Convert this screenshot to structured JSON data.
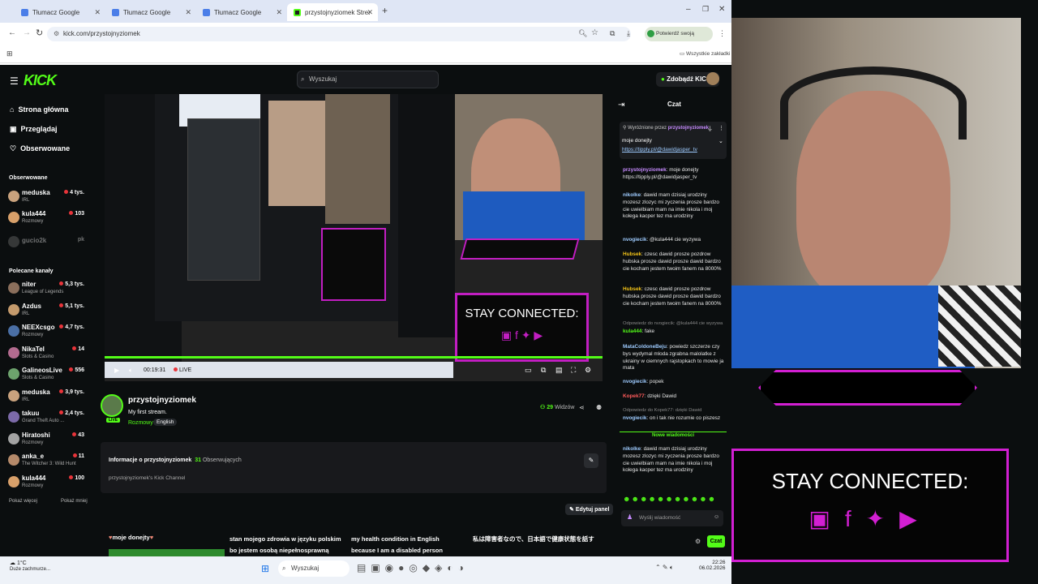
{
  "browser": {
    "tabs": [
      {
        "label": "Tłumacz Google"
      },
      {
        "label": "Tłumacz Google"
      },
      {
        "label": "Tłumacz Google"
      },
      {
        "label": "przystojnyziomek Stream - Wa"
      }
    ],
    "url": "kick.com/przystojnyziomek",
    "verify_label": "Potwierdź swoją tożsamość",
    "all_bookmarks": "Wszystkie zakładki"
  },
  "site": {
    "logo": "KICK",
    "search_placeholder": "Wyszukaj",
    "kicks_button": "Zdobądź KICKs",
    "nav": [
      "Strona główna",
      "Przeglądaj",
      "Obserwowane"
    ],
    "followed_header": "Obserwowane",
    "followed": [
      {
        "name": "meduska",
        "category": "IRL",
        "viewers": "4 tys."
      },
      {
        "name": "kula444",
        "category": "Rozmowy",
        "viewers": "103"
      },
      {
        "name": "gucio2k",
        "category": "",
        "viewers": "pk"
      }
    ],
    "recommended_header": "Polecane kanały",
    "recommended": [
      {
        "name": "niter",
        "category": "League of Legends",
        "viewers": "5,3 tys."
      },
      {
        "name": "Azdus",
        "category": "IRL",
        "viewers": "5,1 tys."
      },
      {
        "name": "NEEXcsgo",
        "category": "Rozmowy",
        "viewers": "4,7 tys."
      },
      {
        "name": "NikaTel",
        "category": "Slots & Casino",
        "viewers": "14"
      },
      {
        "name": "GalineosLive",
        "category": "Slots & Casino",
        "viewers": "556"
      },
      {
        "name": "meduska",
        "category": "IRL",
        "viewers": "3,9 tys."
      },
      {
        "name": "takuu",
        "category": "Grand Theft Auto ...",
        "viewers": "2,4 tys."
      },
      {
        "name": "Hiratoshi",
        "category": "Rozmowy",
        "viewers": "43"
      },
      {
        "name": "anka_e",
        "category": "The Witcher 3: Wild Hunt",
        "viewers": "11"
      },
      {
        "name": "kula444",
        "category": "Rozmowy",
        "viewers": "100"
      }
    ],
    "show_more": "Pokaż więcej",
    "show_less": "Pokaż mniej"
  },
  "player": {
    "time": "00:19:31",
    "live": "LIVE"
  },
  "stream": {
    "channel": "przystojnyziomek",
    "title": "My first stream.",
    "category": "Rozmowy",
    "language": "English",
    "viewers": "29",
    "viewers_label": "Widzów",
    "badge": "LIVE"
  },
  "about": {
    "label": "Informacje o przystojnyziomek",
    "followers_count": "31",
    "followers_label": "Obserwujących",
    "description": "przystojnyziomek's Kick Channel",
    "edit_panel": "Edytuj panel"
  },
  "panels": [
    "moje donejty",
    "stan mojego zdrowia w języku polskim bo jestem osobą niepełnosprawną",
    "my health condition in English because I am a disabled person",
    "私は障害者なので、日本語で健康状態を話す"
  ],
  "chat": {
    "header": "Czat",
    "pinned_prefix": "Wyróżnione przez",
    "pinned_user": "przystojnyziomek",
    "pinned_text": "moje donejty",
    "pinned_link": "https://tipply.pl/@dawidjasper_tv",
    "messages": [
      {
        "user": "przystojnyziomek",
        "text": "moje donejty https://tipply.pl/@dawidjasper_tv"
      },
      {
        "user": "nikolke",
        "text": "dawid mam dzisiaj urodziny mozesz zlozyc mi zyczenia prosze bardzo cie uwielbiam mam na imie nikola i moj kolega kacper tez ma urodziny"
      },
      {
        "user": "nvogiecik",
        "text": "@kula444 cie wyzywa"
      },
      {
        "user": "Hubsek",
        "text": "czesc dawid prosze pozdrow hubska prosze dawid prosze dawid bardzo cie kocham jestem twoim fanem na 8000%"
      },
      {
        "user": "Hubsek",
        "text": "czesc dawid prosze pozdrow hubska prosze dawid prosze dawid bardzo cie kocham jestem twoim fanem na 8000%"
      },
      {
        "user": "kula444",
        "text": "fake",
        "reply": "Odpowiedz do nvogiecik: @kula444 cie wyzywa"
      },
      {
        "user": "MataColdoneBeju",
        "text": "powiedz szczerze czy bys wydymal mloda zgrabna malolatke z ukrainy w ciemnych rajstopkach to mowie ja mata"
      },
      {
        "user": "nvogiecik",
        "text": "popek"
      },
      {
        "user": "Kopek77",
        "text": "dzięki Dawid"
      },
      {
        "user": "nvogiecik",
        "text": "on i tak nie rozumie co piszesz",
        "reply": "Odpowiedz do Kopek77: dzięki Dawid"
      },
      {
        "user": "nikolke",
        "text": "dawid mam dzisiaj urodziny mozesz zlozyc mi zyczenia prosze bardzo cie uwielbiam mam na imie nikola i moj kolega kacper tez ma urodziny"
      }
    ],
    "new_messages": "Nowe wiadomości",
    "input_placeholder": "Wyślij wiadomość",
    "send_button": "Czat"
  },
  "overlay": {
    "stay_connected": "STAY CONNECTED:"
  },
  "taskbar": {
    "temp": "1°C",
    "weather": "Duże zachmurze...",
    "search": "Wyszukaj",
    "time": "22:26",
    "date": "06.02.2026"
  }
}
